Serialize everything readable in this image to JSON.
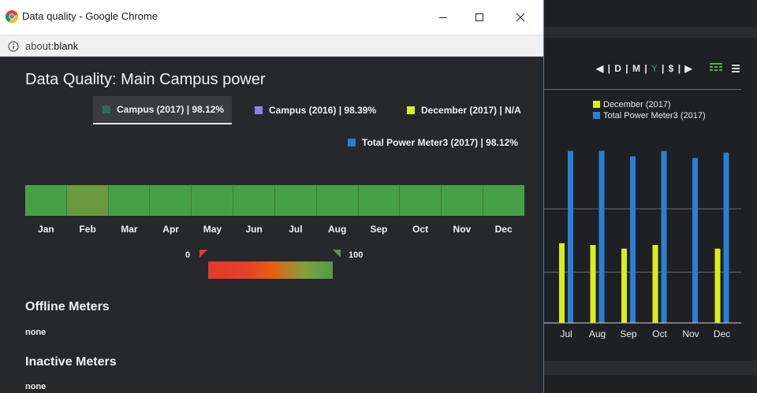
{
  "window": {
    "title": "Data quality - Google Chrome",
    "url_scheme": "about:",
    "url_rest": "blank"
  },
  "page": {
    "title": "Data Quality: Main Campus power",
    "legend": [
      {
        "label": "Campus (2017) | 98.12%",
        "color": "#2e6b4f",
        "active": true
      },
      {
        "label": "Campus (2016) | 98.39%",
        "color": "#8b82f0",
        "active": false
      },
      {
        "label": "December (2017) | N/A",
        "color": "#d8ef1a",
        "active": false
      },
      {
        "label": "Total Power Meter3 (2017) | 98.12%",
        "color": "#2a7fd4",
        "active": false
      }
    ],
    "months": [
      "Jan",
      "Feb",
      "Mar",
      "Apr",
      "May",
      "Jun",
      "Jul",
      "Aug",
      "Sep",
      "Oct",
      "Nov",
      "Dec"
    ],
    "month_quality_colors": [
      "#46a047",
      "#6a9a40",
      "#46a047",
      "#46a047",
      "#46a047",
      "#46a047",
      "#46a047",
      "#46a047",
      "#46a047",
      "#46a047",
      "#46a047",
      "#46a047"
    ],
    "scale": {
      "min": "0",
      "max": "100"
    },
    "offline": {
      "heading": "Offline Meters",
      "value": "none"
    },
    "inactive": {
      "heading": "Inactive Meters",
      "value": "none"
    }
  },
  "dashboard": {
    "nav": {
      "prev": "◀",
      "d": "D",
      "m": "M",
      "y": "Y",
      "dollar": "$",
      "next": "▶",
      "sep": "|"
    },
    "legend": [
      {
        "label": "December (2017)",
        "color": "#d8ef1a"
      },
      {
        "label": "Total Power Meter3 (2017)",
        "color": "#2a7fd4"
      }
    ],
    "chart_data": {
      "type": "bar",
      "categories": [
        "Jul",
        "Aug",
        "Sep",
        "Oct",
        "Nov",
        "Dec"
      ],
      "series": [
        {
          "name": "December (2017)",
          "color": "#d8ef1a",
          "values": [
            0.44,
            0.43,
            0.41,
            0.43,
            0,
            0.41
          ]
        },
        {
          "name": "Total Power Meter3 (2017)",
          "color": "#2a7fd4",
          "values": [
            0.95,
            0.95,
            0.92,
            0.95,
            0.91,
            0.94
          ]
        }
      ],
      "ylim": [
        0,
        1
      ],
      "grid": true
    }
  }
}
